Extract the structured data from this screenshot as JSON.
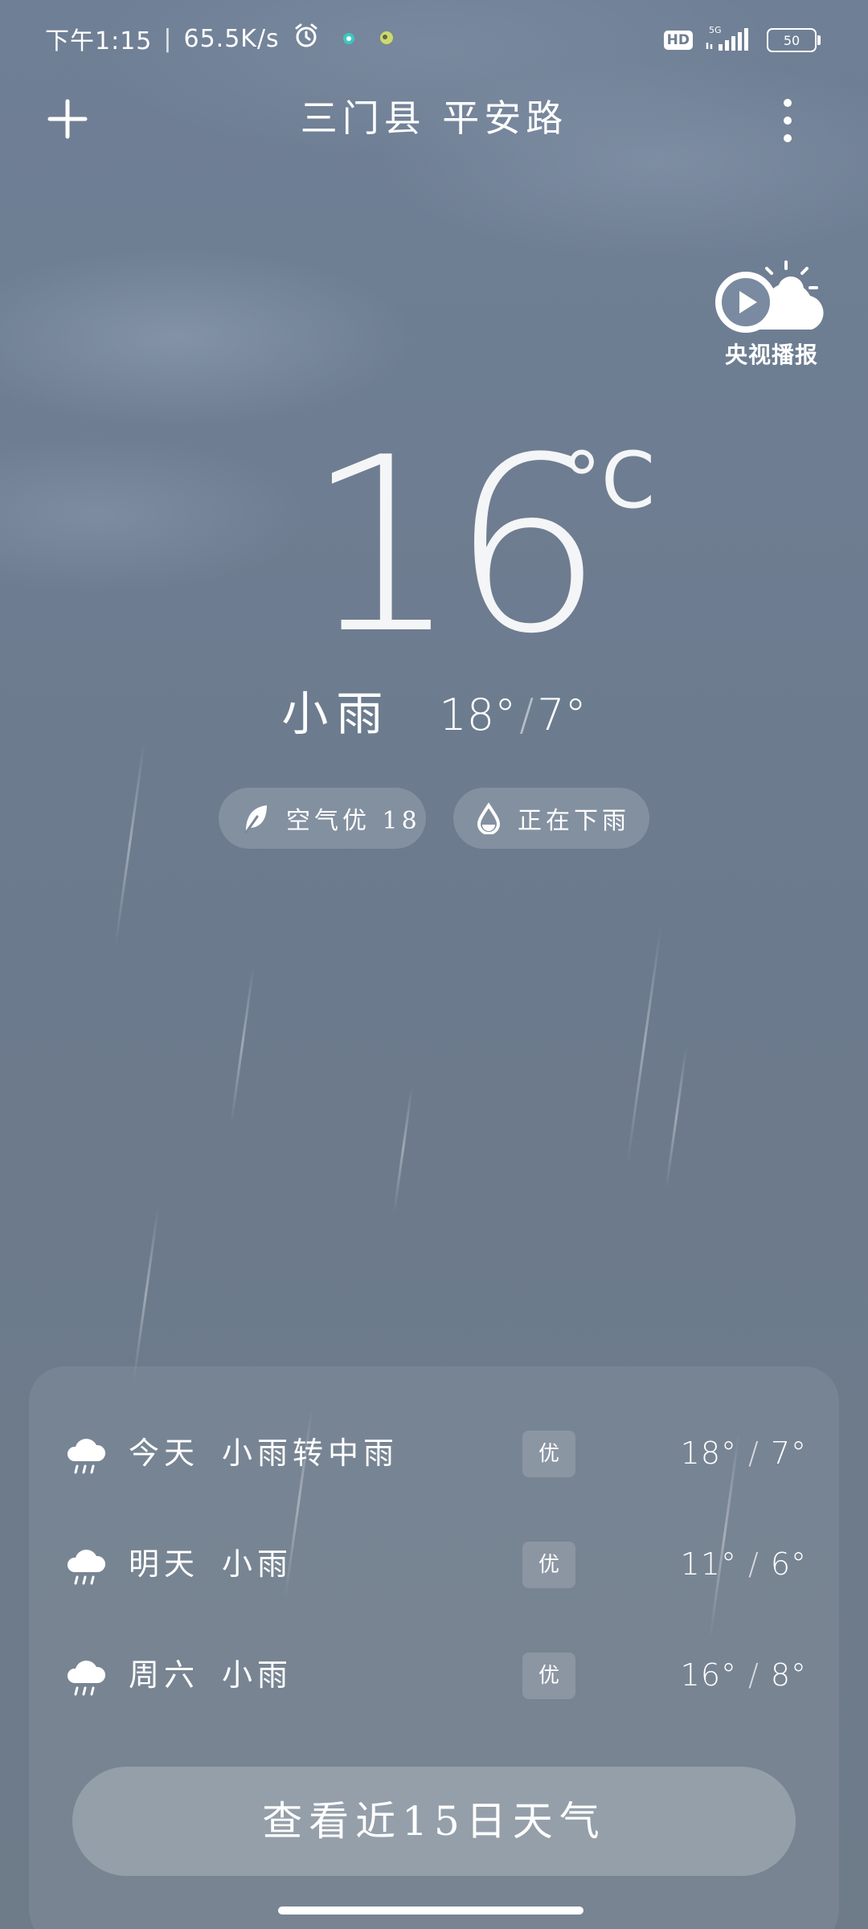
{
  "status_bar": {
    "time": "下午1:15",
    "speed": "65.5K/s",
    "hd": "HD",
    "network": "5G",
    "battery": "50"
  },
  "header": {
    "location": "三门县 平安路"
  },
  "broadcast": {
    "label": "央视播报"
  },
  "current": {
    "temperature": "16",
    "unit": "°C",
    "condition": "小雨",
    "high": "18°",
    "low": "7°",
    "range_separator": "/"
  },
  "chips": {
    "air_quality": "空气优 18",
    "precipitation": "正在下雨"
  },
  "forecast": [
    {
      "day": "今天",
      "condition": "小雨转中雨",
      "aqi": "优",
      "high": "18°",
      "low": "7°"
    },
    {
      "day": "明天",
      "condition": "小雨",
      "aqi": "优",
      "high": "11°",
      "low": "6°"
    },
    {
      "day": "周六",
      "condition": "小雨",
      "aqi": "优",
      "high": "16°",
      "low": "8°"
    }
  ],
  "forecast_separator": "/",
  "forecast_15_label": "查看近15日天气"
}
